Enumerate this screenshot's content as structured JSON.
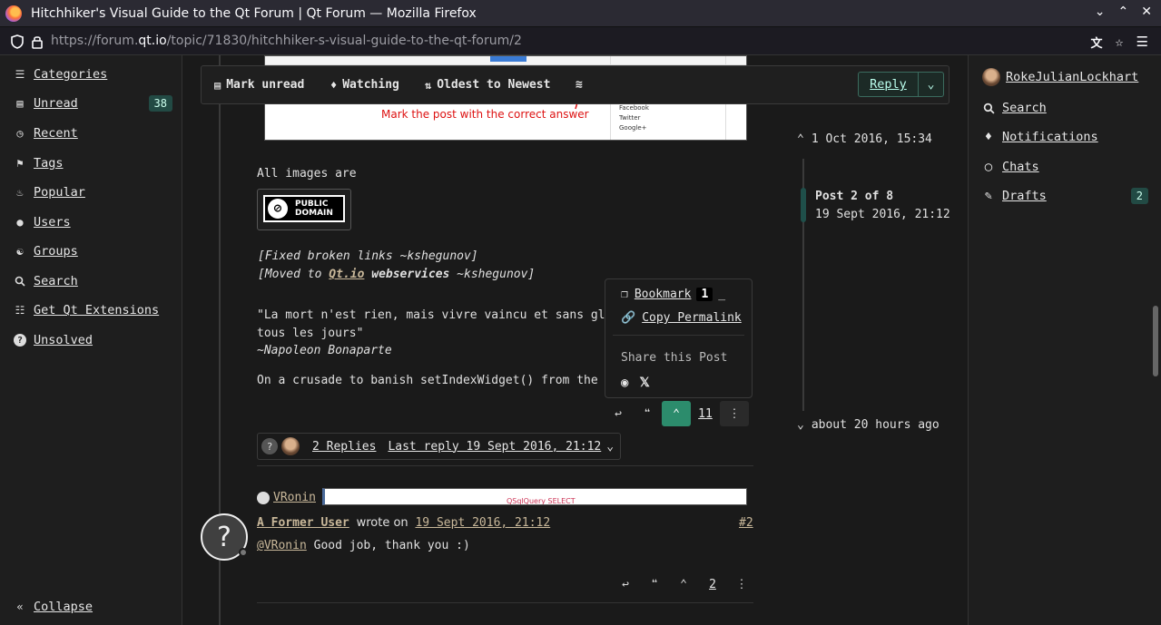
{
  "window": {
    "title": "Hitchhiker's Visual Guide to the Qt Forum | Qt Forum — Mozilla Firefox",
    "url_prefix": "https://forum.",
    "url_host": "qt.io",
    "url_path": "/topic/71830/hitchhiker-s-visual-guide-to-the-qt-forum/2"
  },
  "sidebar": {
    "items": [
      {
        "label": "Categories",
        "icon": "list-icon"
      },
      {
        "label": "Unread",
        "icon": "inbox-icon",
        "badge": "38"
      },
      {
        "label": "Recent",
        "icon": "clock-icon"
      },
      {
        "label": "Tags",
        "icon": "tags-icon"
      },
      {
        "label": "Popular",
        "icon": "fire-icon"
      },
      {
        "label": "Users",
        "icon": "user-icon"
      },
      {
        "label": "Groups",
        "icon": "group-icon"
      },
      {
        "label": "Search",
        "icon": "search-icon"
      },
      {
        "label": "Get Qt Extensions",
        "icon": "bag-icon"
      },
      {
        "label": "Unsolved",
        "icon": "question-icon"
      }
    ],
    "collapse_label": "Collapse"
  },
  "topbar": {
    "mark_unread": "Mark unread",
    "watching": "Watching",
    "sort": "Oldest to Newest",
    "reply": "Reply"
  },
  "post1": {
    "image_caption": "Mark the post with the correct answer",
    "image_social": [
      "Facebook",
      "Twitter",
      "Google+"
    ],
    "all_images": "All images are",
    "badge_text_1": "PUBLIC",
    "badge_text_2": "DOMAIN",
    "fixed_links": "[Fixed broken links ~kshegunov]",
    "moved_prefix": "[Moved to ",
    "moved_link": "Qt.io",
    "moved_bold": "webservices",
    "moved_suffix": " ~kshegunov]",
    "quote_line1": "\"La mort n'est rien, mais vivre vaincu et sans gl",
    "quote_line2": "tous les jours\"",
    "quote_author": "~Napoleon Bonaparte",
    "crusade": "On a crusade to banish setIndexWidget() from the",
    "vote_count": "11",
    "replies_label": "2 Replies",
    "last_reply": "Last reply 19 Sept 2016, 21:12"
  },
  "popup": {
    "bookmark": "Bookmark",
    "bookmark_count": "1",
    "copy_permalink": "Copy Permalink",
    "share_label": "Share this Post"
  },
  "post2": {
    "quoted_user": "VRonin",
    "author": "A Former User",
    "wrote_on": "wrote on",
    "date": "19 Sept 2016, 21:12",
    "index": "#2",
    "mention": "@VRonin",
    "body": " Good job, thank you :)",
    "vote_count": "2",
    "preview_text": "QSqlQuery SELECT"
  },
  "timeline": {
    "top_date": "1 Oct 2016, 15:34",
    "position": "Post 2 of 8",
    "position_date": "19 Sept 2016, 21:12",
    "bottom": "about 20 hours ago"
  },
  "right_sidebar": {
    "username": "RokeJulianLockhart",
    "items": [
      {
        "label": "Search",
        "icon": "search-icon"
      },
      {
        "label": "Notifications",
        "icon": "bell-icon"
      },
      {
        "label": "Chats",
        "icon": "chat-icon"
      },
      {
        "label": "Drafts",
        "icon": "pencil-icon",
        "badge": "2"
      }
    ]
  },
  "colors": {
    "accent": "#2c8c6c",
    "badge_bg": "#224a44",
    "image_caption_red": "#dd1111"
  }
}
